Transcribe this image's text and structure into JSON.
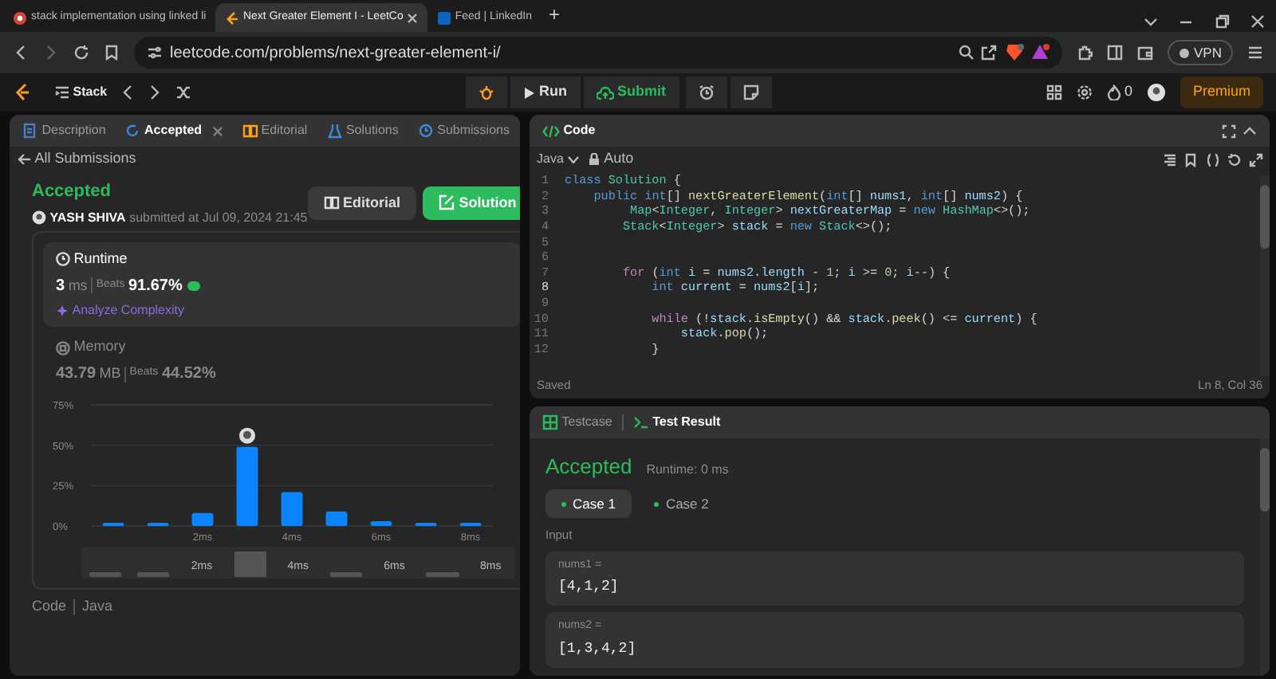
{
  "browser": {
    "tabs": [
      {
        "title": "stack implementation using linked li",
        "selected": false,
        "kind": "circle"
      },
      {
        "title": "Next Greater Element I - LeetCo",
        "selected": true,
        "kind": "logo"
      },
      {
        "title": "Feed | LinkedIn",
        "selected": false,
        "kind": "square"
      }
    ],
    "new_tab": "+",
    "url": "leetcode.com/problems/next-greater-element-i/",
    "vpn": "VPN"
  },
  "topbar": {
    "problem_list": "Stack",
    "run": "Run",
    "submit": "Submit",
    "streak": "0",
    "premium": "Premium"
  },
  "left": {
    "tabs": [
      {
        "label": "Description",
        "selected": false
      },
      {
        "label": "Accepted",
        "selected": true
      },
      {
        "label": "Editorial",
        "selected": false
      },
      {
        "label": "Solutions",
        "selected": false
      },
      {
        "label": "Submissions",
        "selected": false
      }
    ],
    "back": "All Submissions",
    "status": "Accepted",
    "user": "YASH SHIVA",
    "submitted": "submitted at Jul 09, 2024 21:45",
    "buttons": [
      {
        "label": "Editorial",
        "kind": "secondary"
      },
      {
        "label": "Solution",
        "kind": "primary"
      }
    ],
    "metrics": [
      {
        "title": "Runtime",
        "value": "3",
        "unit": "ms",
        "beats_label": "Beats",
        "beats": "91.67%",
        "link": "Analyze Complexity",
        "selected": true
      },
      {
        "title": "Memory",
        "value": "43.79",
        "unit": "MB",
        "beats_label": "Beats",
        "beats": "44.52%",
        "selected": false
      }
    ],
    "chart_data": {
      "type": "bar",
      "x": [
        0,
        1,
        2,
        3,
        4,
        5,
        6,
        7,
        8
      ],
      "values": [
        2,
        2,
        8,
        49,
        21,
        9,
        3,
        2,
        2
      ],
      "xlim": [
        -0.5,
        8.5
      ],
      "ylim": [
        0,
        75
      ],
      "yticks": [
        {
          "value": 0,
          "label": "0%"
        },
        {
          "value": 25,
          "label": "25%"
        },
        {
          "value": 50,
          "label": "50%"
        },
        {
          "value": 75,
          "label": "75%"
        }
      ],
      "xticks": [
        {
          "value": 2,
          "label": "2ms"
        },
        {
          "value": 4,
          "label": "4ms"
        },
        {
          "value": 6,
          "label": "6ms"
        },
        {
          "value": 8,
          "label": "8ms"
        }
      ]
    },
    "overview_labels": [
      "2ms",
      "4ms",
      "6ms",
      "8ms"
    ],
    "footer": [
      "Code",
      "Java"
    ]
  },
  "code": {
    "title": "Code",
    "language": "Java",
    "mode": "Auto",
    "lines": [
      {
        "number": "1",
        "current": false,
        "tokens": [
          {
            "kind": "kw",
            "text": "class "
          },
          {
            "kind": "type",
            "text": "Solution"
          },
          {
            "kind": "p",
            "text": " {"
          }
        ]
      },
      {
        "number": "2",
        "current": false,
        "tokens": [
          {
            "kind": "kw",
            "text": "    public "
          },
          {
            "kind": "kw",
            "text": "int"
          },
          {
            "kind": "p",
            "text": "[] "
          },
          {
            "kind": "fn",
            "text": "nextGreaterElement"
          },
          {
            "kind": "p",
            "text": "("
          },
          {
            "kind": "kw",
            "text": "int"
          },
          {
            "kind": "p",
            "text": "[] "
          },
          {
            "kind": "id",
            "text": "nums1"
          },
          {
            "kind": "p",
            "text": ", "
          },
          {
            "kind": "kw",
            "text": "int"
          },
          {
            "kind": "p",
            "text": "[] "
          },
          {
            "kind": "id",
            "text": "nums2"
          },
          {
            "kind": "p",
            "text": ") {"
          }
        ]
      },
      {
        "number": "3",
        "current": false,
        "tokens": [
          {
            "kind": "type",
            "text": "         Map"
          },
          {
            "kind": "p",
            "text": "<"
          },
          {
            "kind": "type",
            "text": "Integer"
          },
          {
            "kind": "p",
            "text": ", "
          },
          {
            "kind": "type",
            "text": "Integer"
          },
          {
            "kind": "p",
            "text": "> "
          },
          {
            "kind": "id",
            "text": "nextGreaterMap"
          },
          {
            "kind": "p",
            "text": " = "
          },
          {
            "kind": "kw",
            "text": "new "
          },
          {
            "kind": "type",
            "text": "HashMap"
          },
          {
            "kind": "p",
            "text": "<>();"
          }
        ]
      },
      {
        "number": "4",
        "current": false,
        "tokens": [
          {
            "kind": "type",
            "text": "        Stack"
          },
          {
            "kind": "p",
            "text": "<"
          },
          {
            "kind": "type",
            "text": "Integer"
          },
          {
            "kind": "p",
            "text": "> "
          },
          {
            "kind": "id",
            "text": "stack"
          },
          {
            "kind": "p",
            "text": " = "
          },
          {
            "kind": "kw",
            "text": "new "
          },
          {
            "kind": "type",
            "text": "Stack"
          },
          {
            "kind": "p",
            "text": "<>();"
          }
        ]
      },
      {
        "number": "5",
        "current": false
      },
      {
        "number": "6",
        "current": false
      },
      {
        "number": "7",
        "current": false,
        "tokens": [
          {
            "kind": "ctrl",
            "text": "        for "
          },
          {
            "kind": "p",
            "text": "("
          },
          {
            "kind": "kw",
            "text": "int "
          },
          {
            "kind": "id",
            "text": "i"
          },
          {
            "kind": "p",
            "text": " = "
          },
          {
            "kind": "id",
            "text": "nums2"
          },
          {
            "kind": "p",
            "text": "."
          },
          {
            "kind": "id",
            "text": "length"
          },
          {
            "kind": "p",
            "text": " - "
          },
          {
            "kind": "num",
            "text": "1"
          },
          {
            "kind": "p",
            "text": "; "
          },
          {
            "kind": "id",
            "text": "i"
          },
          {
            "kind": "p",
            "text": " >= "
          },
          {
            "kind": "num",
            "text": "0"
          },
          {
            "kind": "p",
            "text": "; "
          },
          {
            "kind": "id",
            "text": "i"
          },
          {
            "kind": "p",
            "text": "--) {"
          }
        ]
      },
      {
        "number": "8",
        "current": true,
        "tokens": [
          {
            "kind": "kw",
            "text": "            int "
          },
          {
            "kind": "id",
            "text": "current"
          },
          {
            "kind": "p",
            "text": " = "
          },
          {
            "kind": "id",
            "text": "nums2"
          },
          {
            "kind": "p",
            "text": "["
          },
          {
            "kind": "id",
            "text": "i"
          },
          {
            "kind": "p",
            "text": "];"
          }
        ]
      },
      {
        "number": "9",
        "current": false
      },
      {
        "number": "10",
        "current": false,
        "tokens": [
          {
            "kind": "ctrl",
            "text": "            while "
          },
          {
            "kind": "p",
            "text": "(!"
          },
          {
            "kind": "id",
            "text": "stack"
          },
          {
            "kind": "p",
            "text": "."
          },
          {
            "kind": "fn",
            "text": "isEmpty"
          },
          {
            "kind": "p",
            "text": "() && "
          },
          {
            "kind": "id",
            "text": "stack"
          },
          {
            "kind": "p",
            "text": "."
          },
          {
            "kind": "fn",
            "text": "peek"
          },
          {
            "kind": "p",
            "text": "() <= "
          },
          {
            "kind": "id",
            "text": "current"
          },
          {
            "kind": "p",
            "text": ") {"
          }
        ]
      },
      {
        "number": "11",
        "current": false,
        "tokens": [
          {
            "kind": "id",
            "text": "                stack"
          },
          {
            "kind": "p",
            "text": "."
          },
          {
            "kind": "fn",
            "text": "pop"
          },
          {
            "kind": "p",
            "text": "();"
          }
        ]
      },
      {
        "number": "12",
        "current": false,
        "tokens": [
          {
            "kind": "p",
            "text": "            }"
          }
        ]
      }
    ],
    "status": "Saved",
    "position": "Ln 8, Col 36"
  },
  "tests": {
    "tabs": [
      {
        "label": "Testcase",
        "selected": false
      },
      {
        "label": "Test Result",
        "selected": true
      }
    ],
    "status": "Accepted",
    "runtime": "Runtime: 0 ms",
    "cases": [
      {
        "label": "Case 1",
        "selected": true
      },
      {
        "label": "Case 2",
        "selected": false
      }
    ],
    "input_label": "Input",
    "inputs": [
      {
        "name": "nums1 =",
        "value": "[4,1,2]"
      },
      {
        "name": "nums2 =",
        "value": "[1,3,4,2]"
      }
    ]
  }
}
